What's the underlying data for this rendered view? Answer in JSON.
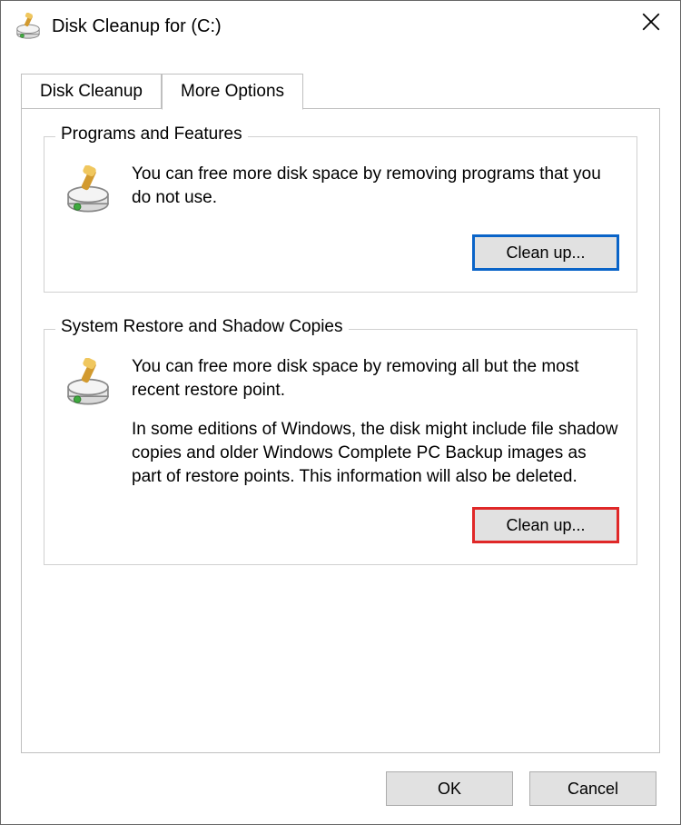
{
  "window": {
    "title": "Disk Cleanup for  (C:)"
  },
  "tabs": {
    "disk_cleanup": "Disk Cleanup",
    "more_options": "More Options"
  },
  "groups": {
    "programs": {
      "title": "Programs and Features",
      "desc": "You can free more disk space by removing programs that you do not use.",
      "button": "Clean up..."
    },
    "restore": {
      "title": "System Restore and Shadow Copies",
      "desc1": "You can free more disk space by removing all but the most recent restore point.",
      "desc2": "In some editions of Windows, the disk might include file shadow copies and older Windows Complete PC Backup images as part of restore points. This information will also be deleted.",
      "button": "Clean up..."
    }
  },
  "footer": {
    "ok": "OK",
    "cancel": "Cancel"
  }
}
